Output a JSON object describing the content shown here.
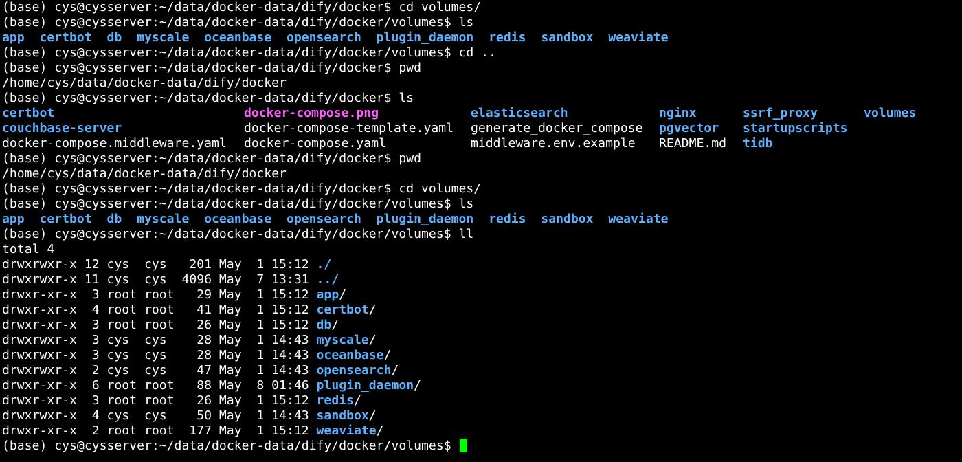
{
  "colors": {
    "background": "#000000",
    "text": "#ffffff",
    "dir": "#5fafff",
    "image": "#ff5fff",
    "cursor": "#00ff00"
  },
  "lines": [
    {
      "type": "text",
      "segments": [
        {
          "text": "(base) cys@cysserver:~/data/docker-data/dify/docker$ cd volumes/",
          "style": "plain"
        }
      ]
    },
    {
      "type": "text",
      "segments": [
        {
          "text": "(base) cys@cysserver:~/data/docker-data/dify/docker/volumes$ ls",
          "style": "plain"
        }
      ]
    },
    {
      "type": "text",
      "segments": [
        {
          "text": "app  certbot  db  myscale  oceanbase  opensearch  plugin_daemon  redis  sandbox  weaviate",
          "style": "dir"
        }
      ]
    },
    {
      "type": "text",
      "segments": [
        {
          "text": "(base) cys@cysserver:~/data/docker-data/dify/docker/volumes$ cd ..",
          "style": "plain"
        }
      ]
    },
    {
      "type": "text",
      "segments": [
        {
          "text": "(base) cys@cysserver:~/data/docker-data/dify/docker$ pwd",
          "style": "plain"
        }
      ]
    },
    {
      "type": "text",
      "segments": [
        {
          "text": "/home/cys/data/docker-data/dify/docker",
          "style": "plain"
        }
      ]
    },
    {
      "type": "text",
      "segments": [
        {
          "text": "(base) cys@cysserver:~/data/docker-data/dify/docker$ ls",
          "style": "plain"
        }
      ]
    },
    {
      "type": "grid",
      "cells": [
        {
          "text": "certbot",
          "style": "dir"
        },
        {
          "text": "docker-compose.png",
          "style": "image"
        },
        {
          "text": "elasticsearch",
          "style": "dir"
        },
        {
          "text": "nginx",
          "style": "dir"
        },
        {
          "text": "ssrf_proxy",
          "style": "dir"
        },
        {
          "text": "volumes",
          "style": "dir"
        }
      ]
    },
    {
      "type": "grid",
      "cells": [
        {
          "text": "couchbase-server",
          "style": "dir"
        },
        {
          "text": "docker-compose-template.yaml",
          "style": "plain"
        },
        {
          "text": "generate_docker_compose",
          "style": "plain"
        },
        {
          "text": "pgvector",
          "style": "dir"
        },
        {
          "text": "startupscripts",
          "style": "dir"
        },
        {
          "text": "",
          "style": "plain"
        }
      ]
    },
    {
      "type": "grid",
      "cells": [
        {
          "text": "docker-compose.middleware.yaml",
          "style": "plain"
        },
        {
          "text": "docker-compose.yaml",
          "style": "plain"
        },
        {
          "text": "middleware.env.example",
          "style": "plain"
        },
        {
          "text": "README.md",
          "style": "plain"
        },
        {
          "text": "tidb",
          "style": "dir"
        },
        {
          "text": "",
          "style": "plain"
        }
      ]
    },
    {
      "type": "text",
      "segments": [
        {
          "text": "(base) cys@cysserver:~/data/docker-data/dify/docker$ pwd",
          "style": "plain"
        }
      ]
    },
    {
      "type": "text",
      "segments": [
        {
          "text": "/home/cys/data/docker-data/dify/docker",
          "style": "plain"
        }
      ]
    },
    {
      "type": "text",
      "segments": [
        {
          "text": "(base) cys@cysserver:~/data/docker-data/dify/docker$ cd volumes/",
          "style": "plain"
        }
      ]
    },
    {
      "type": "text",
      "segments": [
        {
          "text": "(base) cys@cysserver:~/data/docker-data/dify/docker/volumes$ ls",
          "style": "plain"
        }
      ]
    },
    {
      "type": "text",
      "segments": [
        {
          "text": "app  certbot  db  myscale  oceanbase  opensearch  plugin_daemon  redis  sandbox  weaviate",
          "style": "dir"
        }
      ]
    },
    {
      "type": "text",
      "segments": [
        {
          "text": "(base) cys@cysserver:~/data/docker-data/dify/docker/volumes$ ll",
          "style": "plain"
        }
      ]
    },
    {
      "type": "text",
      "segments": [
        {
          "text": "total 4",
          "style": "plain"
        }
      ]
    },
    {
      "type": "text",
      "segments": [
        {
          "text": "drwxrwxr-x 12 cys  cys   201 May  1 15:12 ",
          "style": "plain"
        },
        {
          "text": "./",
          "style": "dir"
        }
      ]
    },
    {
      "type": "text",
      "segments": [
        {
          "text": "drwxrwxr-x 11 cys  cys  4096 May  7 13:31 ",
          "style": "plain"
        },
        {
          "text": "../",
          "style": "dir"
        }
      ]
    },
    {
      "type": "text",
      "segments": [
        {
          "text": "drwxr-xr-x  3 root root   29 May  1 15:12 ",
          "style": "plain"
        },
        {
          "text": "app",
          "style": "dir"
        },
        {
          "text": "/",
          "style": "plain"
        }
      ]
    },
    {
      "type": "text",
      "segments": [
        {
          "text": "drwxr-xr-x  4 root root   41 May  1 15:12 ",
          "style": "plain"
        },
        {
          "text": "certbot",
          "style": "dir"
        },
        {
          "text": "/",
          "style": "plain"
        }
      ]
    },
    {
      "type": "text",
      "segments": [
        {
          "text": "drwxr-xr-x  3 root root   26 May  1 15:12 ",
          "style": "plain"
        },
        {
          "text": "db",
          "style": "dir"
        },
        {
          "text": "/",
          "style": "plain"
        }
      ]
    },
    {
      "type": "text",
      "segments": [
        {
          "text": "drwxrwxr-x  3 cys  cys    28 May  1 14:43 ",
          "style": "plain"
        },
        {
          "text": "myscale",
          "style": "dir"
        },
        {
          "text": "/",
          "style": "plain"
        }
      ]
    },
    {
      "type": "text",
      "segments": [
        {
          "text": "drwxrwxr-x  3 cys  cys    28 May  1 14:43 ",
          "style": "plain"
        },
        {
          "text": "oceanbase",
          "style": "dir"
        },
        {
          "text": "/",
          "style": "plain"
        }
      ]
    },
    {
      "type": "text",
      "segments": [
        {
          "text": "drwxrwxr-x  2 cys  cys    47 May  1 14:43 ",
          "style": "plain"
        },
        {
          "text": "opensearch",
          "style": "dir"
        },
        {
          "text": "/",
          "style": "plain"
        }
      ]
    },
    {
      "type": "text",
      "segments": [
        {
          "text": "drwxr-xr-x  6 root root   88 May  8 01:46 ",
          "style": "plain"
        },
        {
          "text": "plugin_daemon",
          "style": "dir"
        },
        {
          "text": "/",
          "style": "plain"
        }
      ]
    },
    {
      "type": "text",
      "segments": [
        {
          "text": "drwxr-xr-x  3 root root   26 May  1 15:12 ",
          "style": "plain"
        },
        {
          "text": "redis",
          "style": "dir"
        },
        {
          "text": "/",
          "style": "plain"
        }
      ]
    },
    {
      "type": "text",
      "segments": [
        {
          "text": "drwxrwxr-x  4 cys  cys    50 May  1 14:43 ",
          "style": "plain"
        },
        {
          "text": "sandbox",
          "style": "dir"
        },
        {
          "text": "/",
          "style": "plain"
        }
      ]
    },
    {
      "type": "text",
      "segments": [
        {
          "text": "drwxr-xr-x  2 root root  177 May  1 15:12 ",
          "style": "plain"
        },
        {
          "text": "weaviate",
          "style": "dir"
        },
        {
          "text": "/",
          "style": "plain"
        }
      ]
    },
    {
      "type": "prompt",
      "segments": [
        {
          "text": "(base) cys@cysserver:~/data/docker-data/dify/docker/volumes$ ",
          "style": "plain"
        }
      ]
    }
  ]
}
